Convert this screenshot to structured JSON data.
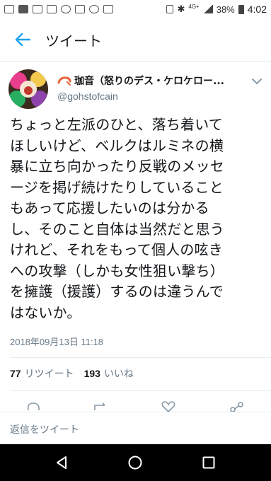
{
  "status_bar": {
    "network": "4G",
    "network_sup": "+",
    "battery": "38%",
    "time": "4:02"
  },
  "app_bar": {
    "title": "ツイート",
    "back_icon": "arrow-left-icon"
  },
  "tweet": {
    "author_emoji": "shrimp-icon",
    "author_name": "珈音（怒りのデス・ケロケロー...",
    "author_handle": "@gohstofcain",
    "text_lines": [
      "ちょっと左派のひと、落ち着いて",
      "ほしいけど、ベルクはルミネの横",
      "暴に立ち向かったり反戦のメッセ",
      "ージを掲げ続けたりしていること",
      "もあって応援したいのは分かる",
      "し、そのこと自体は当然だと思う",
      "けれど、それをもって個人の呟き",
      "への攻撃（しかも女性狙い撃ち）",
      "を擁護（援護）するのは違うんで",
      "はないか。"
    ],
    "timestamp": "2018年09月13日 11:18",
    "retweets_count": "77",
    "retweets_label": "リツイート",
    "likes_count": "193",
    "likes_label": "いいね"
  },
  "reply_bar": {
    "placeholder": "返信をツイート"
  },
  "accent_color": "#1da1f2"
}
